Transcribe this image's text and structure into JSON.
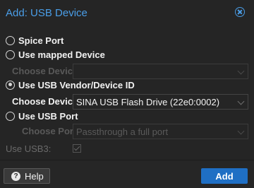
{
  "dialog": {
    "title": "Add: USB Device"
  },
  "options": {
    "spice_port": "Spice Port",
    "mapped_device": "Use mapped Device",
    "vendor_device_id": "Use USB Vendor/Device ID",
    "usb_port": "Use USB Port"
  },
  "mapped": {
    "choose_label": "Choose Device:"
  },
  "vendor": {
    "choose_label": "Choose Device:",
    "selected_value": "SINA USB Flash Drive (22e0:0002)"
  },
  "port": {
    "choose_label": "Choose Port:",
    "value": "Passthrough a full port"
  },
  "usb3": {
    "label": "Use USB3:",
    "checked": true
  },
  "footer": {
    "help_label": "Help",
    "help_icon_glyph": "?",
    "add_label": "Add"
  },
  "colors": {
    "accent": "#4a9ee8",
    "primary_button": "#1f6fc4",
    "background": "#252525"
  }
}
